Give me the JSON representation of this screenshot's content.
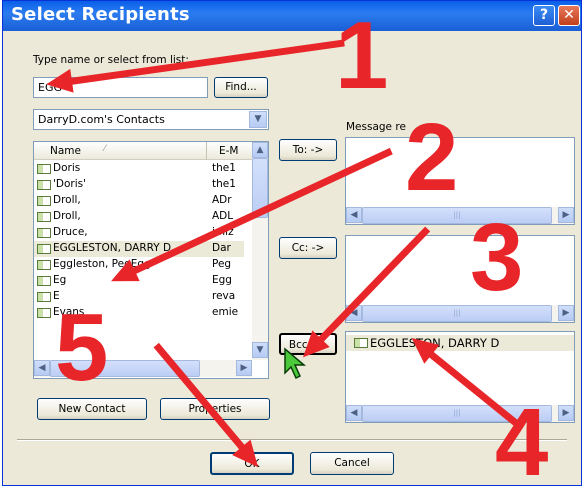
{
  "window": {
    "title": "Select Recipients",
    "help_label": "?",
    "close_label": "✕"
  },
  "search": {
    "label": "Type name or select from list:",
    "value": "EGG",
    "find_label": "Find..."
  },
  "address_book": {
    "selected": "DarryD.com's Contacts"
  },
  "contact_list": {
    "columns": [
      "Name",
      "E-M"
    ],
    "rows": [
      {
        "name": "Doris",
        "email": "the1"
      },
      {
        "name": "'Doris'",
        "email": "the1"
      },
      {
        "name": "Droll,",
        "email": "ADr"
      },
      {
        "name": "Droll,",
        "email": "ADL"
      },
      {
        "name": "Druce,",
        "email": "jmiz"
      },
      {
        "name": "EGGLESTON, DARRY D",
        "email": "Dar"
      },
      {
        "name": "Eggleston, PegEgg",
        "email": "Peg"
      },
      {
        "name": "Eg",
        "email": "Egg"
      },
      {
        "name": "E",
        "email": "reva"
      },
      {
        "name": "Evans",
        "email": "emie"
      }
    ]
  },
  "recipients": {
    "label": "Message re",
    "to_label": "To: ->",
    "cc_label": "Cc: ->",
    "bcc_label": "Bcc: ->",
    "bcc_entries": [
      "EGGLESTON, DARRY D"
    ]
  },
  "footer": {
    "new_contact_label": "New Contact",
    "properties_label": "Properties",
    "ok_label": "OK",
    "cancel_label": "Cancel"
  },
  "annotations": {
    "numbers": [
      "1",
      "2",
      "3",
      "4",
      "5"
    ],
    "color": "#e8262a"
  }
}
